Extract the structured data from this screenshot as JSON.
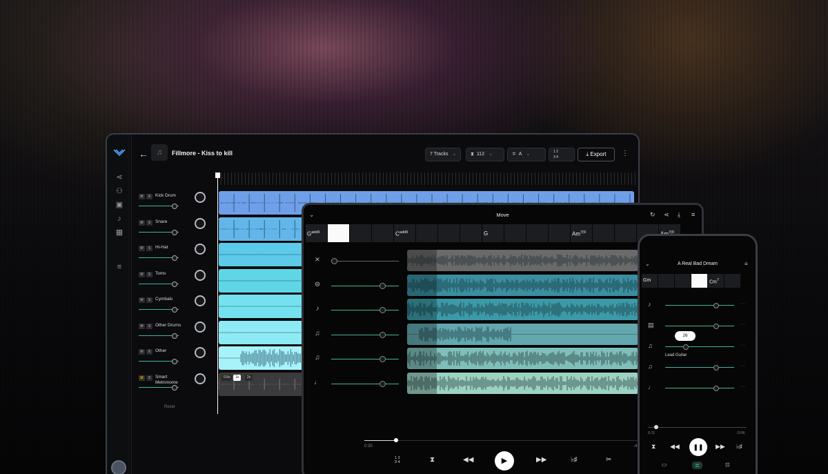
{
  "laptop": {
    "song_title": "Fillmore - Kiss to kill",
    "tracks_pill": "7 Tracks",
    "tempo": "112",
    "key": "A",
    "time_sig": "1 2\n3 4",
    "export_label": "Export",
    "reset_label": "Reset",
    "mute_label": "M",
    "solo_label": "S",
    "speeds": [
      "0.5x",
      "1x",
      "2x"
    ],
    "selected_speed": "1x",
    "tracks": [
      {
        "name": "Kick Drum",
        "color": "#6f9fe8"
      },
      {
        "name": "Snare",
        "color": "#63b6ea"
      },
      {
        "name": "Hi-Hat",
        "color": "#5ccae8"
      },
      {
        "name": "Toms",
        "color": "#5fd6e6"
      },
      {
        "name": "Cymbals",
        "color": "#74e2ee"
      },
      {
        "name": "Other Drums",
        "color": "#8eeaf4"
      },
      {
        "name": "Other",
        "color": "#a8f2fa"
      },
      {
        "name": "Smart Metronome",
        "color": "#3b3b3d"
      }
    ]
  },
  "tablet": {
    "title": "Move",
    "chords": [
      {
        "root": "G",
        "ext": "add9"
      },
      {
        "root": "",
        "ext": "",
        "highlight": true
      },
      {
        "root": "",
        "ext": ""
      },
      {
        "root": "",
        "ext": ""
      },
      {
        "root": "C",
        "ext": "add9"
      },
      {
        "root": "",
        "ext": ""
      },
      {
        "root": "",
        "ext": ""
      },
      {
        "root": "",
        "ext": ""
      },
      {
        "root": "G",
        "ext": ""
      },
      {
        "root": "",
        "ext": ""
      },
      {
        "root": "",
        "ext": ""
      },
      {
        "root": "",
        "ext": ""
      },
      {
        "root": "Am",
        "ext": "7(9"
      },
      {
        "root": "",
        "ext": ""
      },
      {
        "root": "",
        "ext": ""
      },
      {
        "root": "",
        "ext": ""
      },
      {
        "root": "Am",
        "ext": "7(9"
      }
    ],
    "time_elapsed": "0:30",
    "time_remaining": "-4",
    "rows": [
      {
        "icon": "metronome-off-icon",
        "glyph": "⨯",
        "color": "#6a6a6a"
      },
      {
        "icon": "drum-icon",
        "glyph": "⊜",
        "color": "#3a8ea0"
      },
      {
        "icon": "bass-icon",
        "glyph": "♪",
        "color": "#3c9aa8"
      },
      {
        "icon": "guitar-1-icon",
        "glyph": "♫",
        "color": "#62a8ae"
      },
      {
        "icon": "guitar-2-icon",
        "glyph": "♫",
        "color": "#7fbfba"
      },
      {
        "icon": "music-note-icon",
        "glyph": "♩",
        "color": "#9bd2c2"
      }
    ],
    "sig_label": "1 2\n3 4",
    "key_label": "♭♯"
  },
  "phone": {
    "title": "A Real Bad Dream",
    "chords": [
      {
        "root": "Gm",
        "ext": ""
      },
      {
        "root": "",
        "ext": ""
      },
      {
        "root": "",
        "ext": ""
      },
      {
        "root": "",
        "ext": "",
        "highlight": true
      },
      {
        "root": "Cm",
        "ext": "7"
      },
      {
        "root": "",
        "ext": ""
      }
    ],
    "bubble_value": "26",
    "lead_label": "Lead Guitar",
    "time_elapsed": "0:11",
    "time_remaining": "-2:06",
    "key_label": "♭♯",
    "dots": "···"
  }
}
